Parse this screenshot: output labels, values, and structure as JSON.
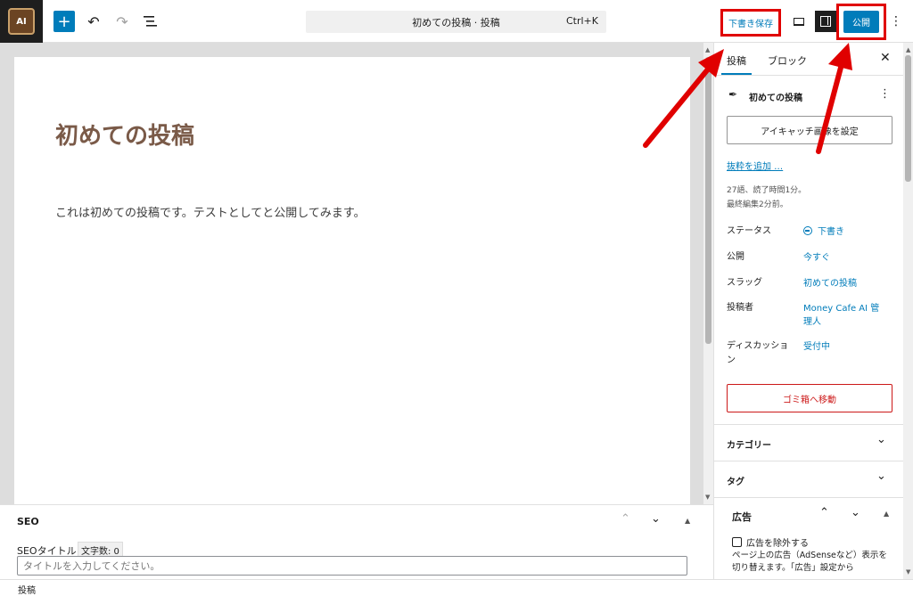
{
  "toolbar": {
    "logo_text": "AI",
    "add_icon": "plus-icon",
    "undo_icon": "undo-icon",
    "redo_icon": "redo-icon",
    "list_icon": "list-view-icon",
    "command_title": "初めての投稿 · 投稿",
    "command_shortcut": "Ctrl+K",
    "save_draft_label": "下書き保存",
    "publish_label": "公開"
  },
  "editor": {
    "title": "初めての投稿",
    "body": "これは初めての投稿です。テストとしてと公開してみます。"
  },
  "seo": {
    "heading": "SEO",
    "title_label": "SEOタイトル",
    "char_count": "文字数: 0",
    "title_placeholder": "タイトルを入力してください。"
  },
  "statusbar": {
    "breadcrumb": "投稿"
  },
  "sidebar": {
    "tabs": [
      {
        "label": "投稿",
        "active": true
      },
      {
        "label": "ブロック",
        "active": false
      }
    ],
    "post_title": "初めての投稿",
    "featured_image_label": "アイキャッチ画像を設定",
    "excerpt_link": "抜粋を追加 …",
    "word_info": "27語、読了時間1分。",
    "last_edited": "最終編集2分前。",
    "rows": [
      {
        "label": "ステータス",
        "value": "下書き"
      },
      {
        "label": "公開",
        "value": "今すぐ"
      },
      {
        "label": "スラッグ",
        "value": "初めての投稿"
      },
      {
        "label": "投稿者",
        "value": "Money Cafe AI 管理人"
      },
      {
        "label": "ディスカッション",
        "value": "受付中"
      }
    ],
    "trash_label": "ゴミ箱へ移動",
    "panels": [
      {
        "label": "カテゴリー"
      },
      {
        "label": "タグ"
      }
    ],
    "ad": {
      "heading": "広告",
      "checkbox_label": "広告を除外する",
      "description": "ページ上の広告（AdSenseなど）表示を切り替えます。「広告」設定から"
    }
  },
  "colors": {
    "accent": "#007cba",
    "annotation": "#e00000",
    "title_brown": "#7a5a48",
    "danger": "#cc1818"
  }
}
